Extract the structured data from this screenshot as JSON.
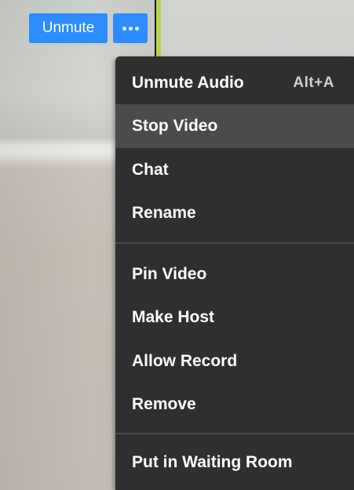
{
  "controls": {
    "unmute_label": "Unmute",
    "more_icon": "more-horizontal-icon",
    "accent_color": "#2d8cff"
  },
  "video": {
    "active_speaker_color": "#b7d54e"
  },
  "menu": {
    "background_color": "#2f2f30",
    "highlight_color": "#4b4b4c",
    "highlighted_item": "Stop Video",
    "items": [
      {
        "label": "Unmute Audio",
        "shortcut": "Alt+A"
      },
      {
        "label": "Stop Video"
      },
      {
        "label": "Chat"
      },
      {
        "label": "Rename"
      },
      {
        "label": "Pin Video"
      },
      {
        "label": "Make Host"
      },
      {
        "label": "Allow Record"
      },
      {
        "label": "Remove"
      },
      {
        "label": "Put in Waiting Room"
      }
    ]
  }
}
